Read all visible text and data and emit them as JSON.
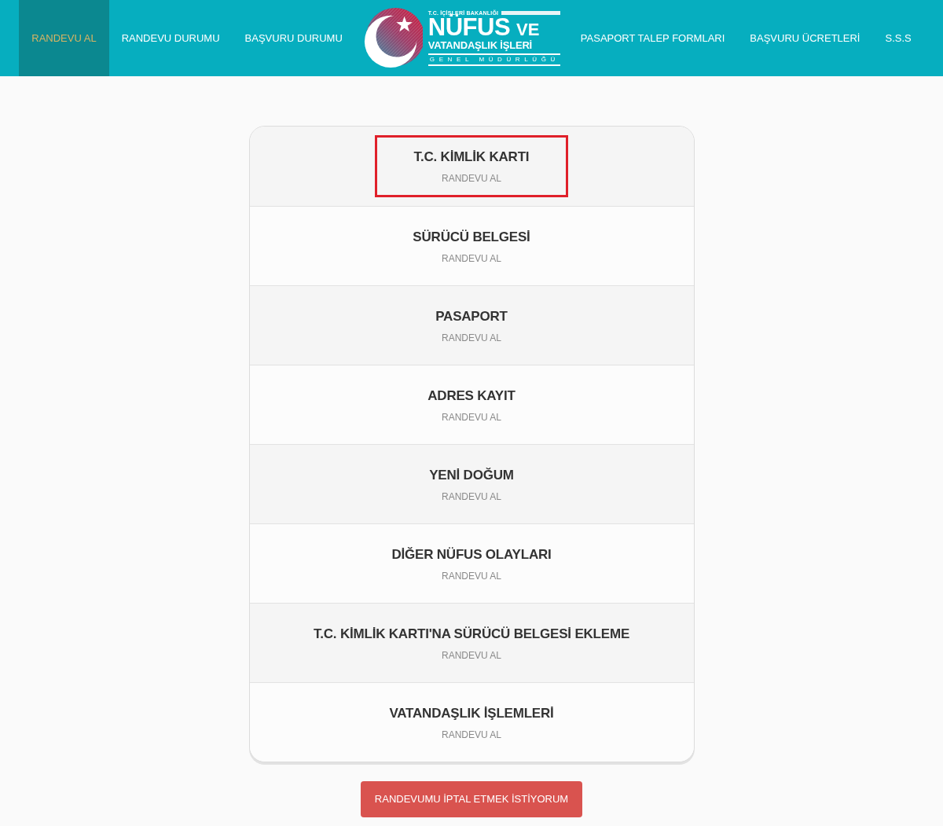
{
  "navbar": {
    "items_left": [
      {
        "label": "RANDEVU AL",
        "selected": true
      },
      {
        "label": "RANDEVU DURUMU",
        "selected": false
      },
      {
        "label": "BAŞVURU DURUMU",
        "selected": false
      }
    ],
    "logo": {
      "ministry": "T.C. İÇİŞLERİ BAKANLIĞI",
      "title": "NÜFUS",
      "title_suffix": "VE",
      "subtitle": "VATANDAŞLIK İŞLERİ",
      "footer": "GENEL MÜDÜRLÜĞÜ"
    },
    "items_right": [
      {
        "label": "PASAPORT TALEP FORMLARI",
        "selected": false
      },
      {
        "label": "BAŞVURU ÜCRETLERİ",
        "selected": false
      },
      {
        "label": "S.S.S",
        "selected": false
      }
    ]
  },
  "services": [
    {
      "title": "T.C. KİMLİK KARTI",
      "action": "RANDEVU AL",
      "highlighted": true
    },
    {
      "title": "SÜRÜCÜ BELGESİ",
      "action": "RANDEVU AL",
      "highlighted": false
    },
    {
      "title": "PASAPORT",
      "action": "RANDEVU AL",
      "highlighted": false
    },
    {
      "title": "ADRES KAYIT",
      "action": "RANDEVU AL",
      "highlighted": false
    },
    {
      "title": "YENİ DOĞUM",
      "action": "RANDEVU AL",
      "highlighted": false
    },
    {
      "title": "DİĞER NÜFUS OLAYLARI",
      "action": "RANDEVU AL",
      "highlighted": false
    },
    {
      "title": "T.C. KİMLİK KARTI'NA SÜRÜCÜ BELGESİ EKLEME",
      "action": "RANDEVU AL",
      "highlighted": false
    },
    {
      "title": "VATANDAŞLIK İŞLEMLERİ",
      "action": "RANDEVU AL",
      "highlighted": false
    }
  ],
  "cancel_button": "RANDEVUMU İPTAL ETMEK İSTİYORUM"
}
